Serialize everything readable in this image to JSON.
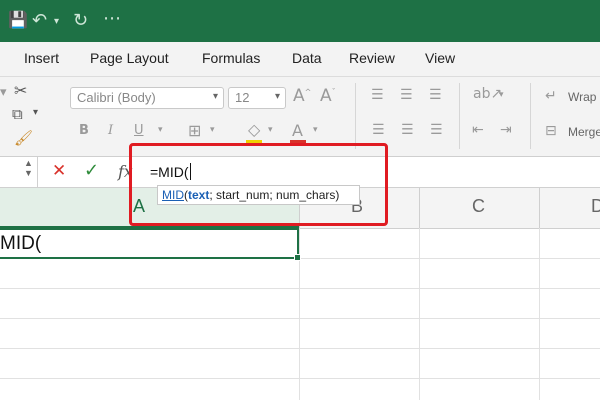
{
  "titlebar": {
    "icons": [
      "save-icon",
      "undo-icon",
      "redo-icon",
      "more-icon"
    ]
  },
  "menu": {
    "tabs": [
      "Insert",
      "Page Layout",
      "Formulas",
      "Data",
      "Review",
      "View"
    ]
  },
  "ribbon": {
    "font_name": "Calibri (Body)",
    "font_size": "12",
    "wrap_label": "Wrap",
    "merge_label": "Merge"
  },
  "formula_bar": {
    "fx_label": "fx",
    "content": "=MID("
  },
  "tooltip": {
    "fn": "MID",
    "open": "(",
    "arg1": "text",
    "rest": "; start_num; num_chars)"
  },
  "columns": [
    "A",
    "B",
    "C",
    "D"
  ],
  "cell": {
    "value": "MID("
  },
  "colors": {
    "title_green": "#1e7145",
    "highlight_red": "#e01b22",
    "cell_border": "#1e7145"
  }
}
